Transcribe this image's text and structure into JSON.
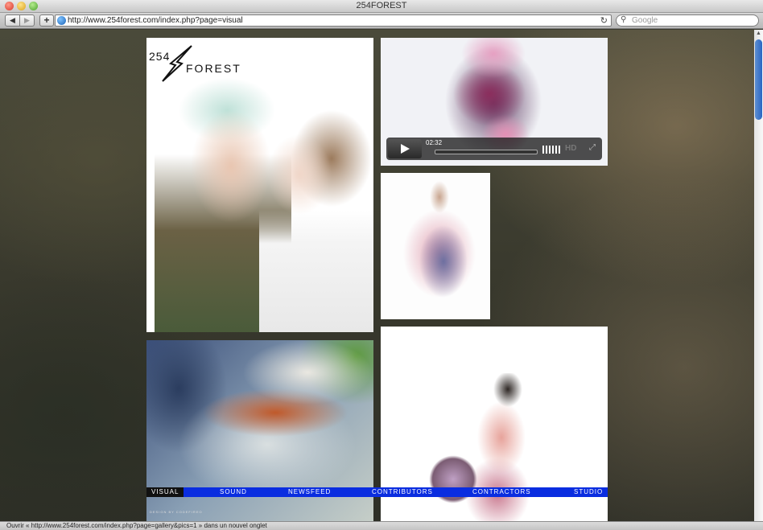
{
  "window": {
    "title": "254FOREST"
  },
  "toolbar": {
    "back_icon": "◀",
    "forward_icon": "▶",
    "add_icon": "+",
    "url": "http://www.254forest.com/index.php?page=visual",
    "reload_icon": "↻",
    "search_placeholder": "Google",
    "search_icon": "⚲"
  },
  "site": {
    "logo_number": "254",
    "logo_word": "FOREST",
    "video": {
      "time": "02:32",
      "hd_label": "HD",
      "fullscreen_icon": "⤢"
    },
    "credit": "DESIGN BY CODEFIREO",
    "nav": [
      {
        "label": "VISUAL",
        "active": true
      },
      {
        "label": "SOUND"
      },
      {
        "label": "NEWSFEED"
      },
      {
        "label": "CONTRIBUTORS"
      },
      {
        "label": "CONTRACTORS"
      },
      {
        "label": "STUDIO"
      }
    ]
  },
  "status": {
    "text": "Ouvrir « http://www.254forest.com/index.php?page=gallery&pics=1 » dans un nouvel onglet"
  },
  "colors": {
    "nav_bar": "#0a2de0",
    "nav_active": "#111111",
    "scroll_thumb": "#2a66c3"
  }
}
